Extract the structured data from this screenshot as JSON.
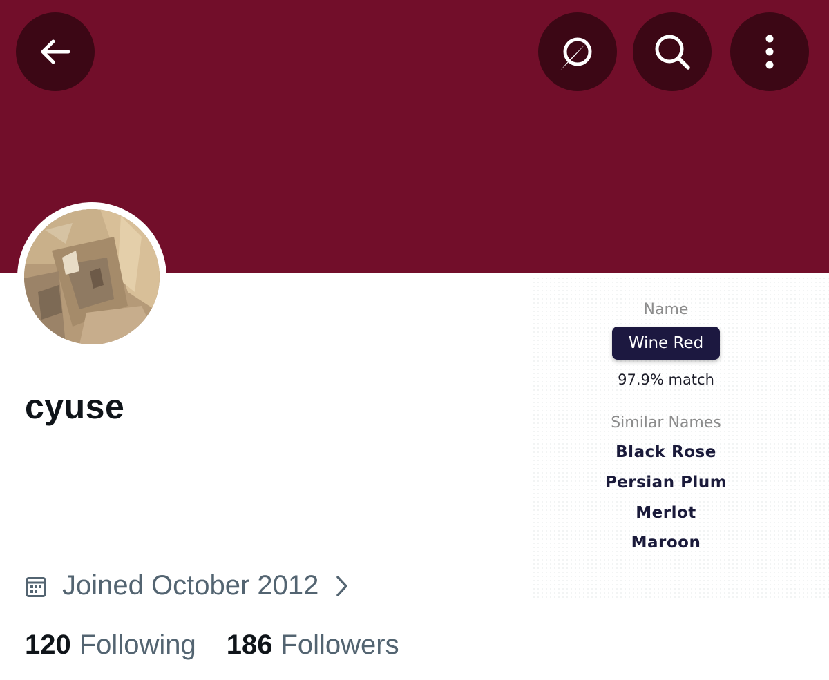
{
  "profile": {
    "display_name": "cyuse",
    "joined": "Joined October 2012",
    "following_count": "120",
    "following_label": "Following",
    "followers_count": "186",
    "followers_label": "Followers"
  },
  "colors": {
    "banner": "#720e2a",
    "header_button": "#3c0715",
    "badge": "#1c1840",
    "secondary_text": "#536471"
  },
  "header": {
    "icons": [
      "back-arrow-icon",
      "grok-icon",
      "search-icon",
      "more-vertical-icon"
    ]
  },
  "color_panel": {
    "name_label": "Name",
    "name_value": "Wine Red",
    "match": "97.9% match",
    "similar_label": "Similar Names",
    "similar": [
      "Black Rose",
      "Persian Plum",
      "Merlot",
      "Maroon"
    ]
  }
}
